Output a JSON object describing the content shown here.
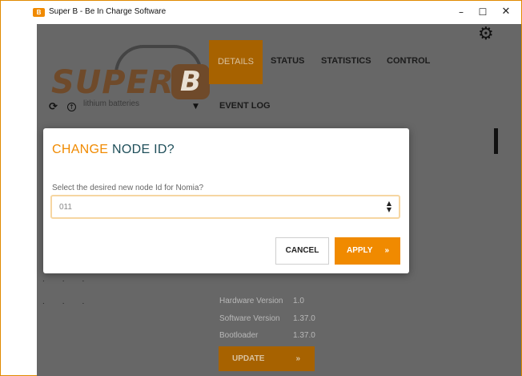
{
  "window": {
    "title": "Super B - Be In Charge Software",
    "app_icon_letter": "B",
    "minimize": "–",
    "maximize": "☐",
    "close": "✕"
  },
  "logo": {
    "wordmark": "SUPER",
    "badge": "B",
    "subtitle": "lithium batteries"
  },
  "nav": {
    "tabs": [
      {
        "label": "DETAILS",
        "active": true
      },
      {
        "label": "STATUS"
      },
      {
        "label": "STATISTICS"
      },
      {
        "label": "CONTROL"
      },
      {
        "label": "EVENT LOG"
      }
    ]
  },
  "icons": {
    "settings": "gear-icon",
    "refresh": "refresh-icon",
    "upload": "upload-icon",
    "caret": "chevron-down-icon"
  },
  "glyphs": {
    "gear": "⚙",
    "refresh": "⟳",
    "upload": "↑",
    "caret": "▼",
    "select_arrows_up": "▲",
    "select_arrows_down": "▼",
    "chevrons": "»"
  },
  "sidebar": {
    "dots_row_1": "...",
    "dots_row_2": "..."
  },
  "info": {
    "rows": [
      {
        "label": "Hardware Version",
        "value": "1.0"
      },
      {
        "label": "Software Version",
        "value": "1.37.0"
      },
      {
        "label": "Bootloader",
        "value": "1.37.0"
      }
    ],
    "update_label": "UPDATE"
  },
  "dialog": {
    "title_accent": "CHANGE",
    "title_rest": " NODE ID?",
    "prompt": "Select the desired new node Id for Nomia?",
    "selected_value": "011",
    "cancel_label": "CANCEL",
    "apply_label": "APPLY"
  },
  "colors": {
    "accent": "#f08a00",
    "overlay": "#676767",
    "title_dark": "#1f4f5a"
  }
}
